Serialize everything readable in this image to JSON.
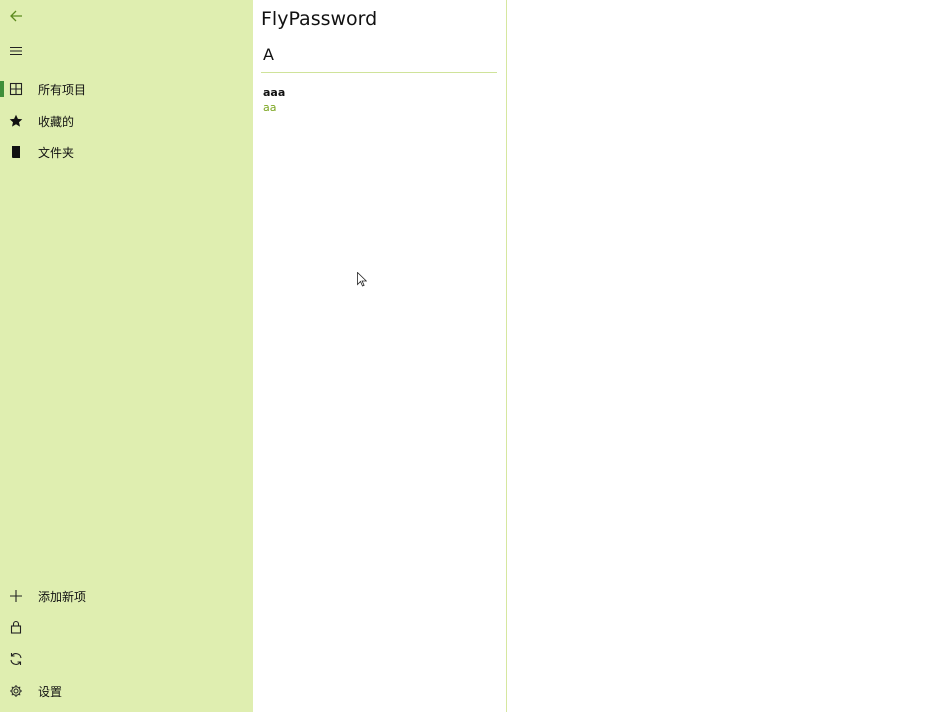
{
  "app": {
    "title": "FlyPassword"
  },
  "sidebar": {
    "top": [
      {
        "name": "back-button",
        "icon": "back-arrow-icon",
        "label": ""
      },
      {
        "name": "hamburger-menu-button",
        "icon": "hamburger-icon",
        "label": ""
      }
    ],
    "nav": [
      {
        "icon": "grid-icon",
        "label": "所有项目",
        "selected": true
      },
      {
        "icon": "star-icon",
        "label": "收藏的",
        "selected": false
      },
      {
        "icon": "folder-icon",
        "label": "文件夹",
        "selected": false
      }
    ],
    "bottom": [
      {
        "icon": "plus-icon",
        "label": "添加新项"
      },
      {
        "icon": "lock-icon",
        "label": ""
      },
      {
        "icon": "sync-icon",
        "label": ""
      },
      {
        "icon": "gear-icon",
        "label": "设置"
      }
    ]
  },
  "list": {
    "group_header": "A",
    "items": [
      {
        "title": "aaa",
        "subtitle": "aa"
      }
    ]
  },
  "colors": {
    "sidebar_bg": "#dfeeb0",
    "accent": "#3f8f3a",
    "subtitle": "#7aa51f"
  }
}
